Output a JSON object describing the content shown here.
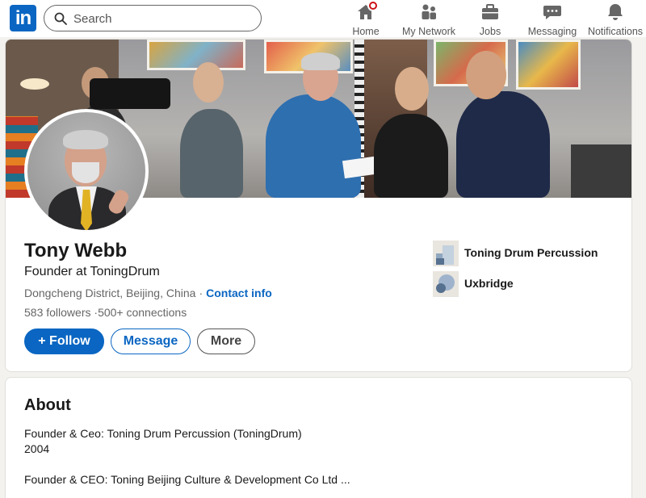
{
  "nav": {
    "logo": "in",
    "search_placeholder": "Search",
    "items": [
      {
        "label": "Home",
        "icon": "home-icon"
      },
      {
        "label": "My Network",
        "icon": "network-icon"
      },
      {
        "label": "Jobs",
        "icon": "briefcase-icon"
      },
      {
        "label": "Messaging",
        "icon": "messaging-icon"
      },
      {
        "label": "Notifications",
        "icon": "bell-icon"
      }
    ]
  },
  "profile": {
    "name": "Tony Webb",
    "headline": "Founder at ToningDrum",
    "location": "Dongcheng District, Beijing, China",
    "separator": "·",
    "contact_info": "Contact info",
    "followers": "583 followers",
    "connections": "500+ connections",
    "buttons": {
      "follow": "+ Follow",
      "message": "Message",
      "more": "More"
    },
    "orgs": [
      {
        "name": "Toning Drum Percussion",
        "icon": "company-logo-icon"
      },
      {
        "name": "Uxbridge",
        "icon": "school-logo-icon"
      }
    ]
  },
  "about": {
    "title": "About",
    "lines": [
      "Founder & Ceo: Toning Drum Percussion (ToningDrum)",
      "2004",
      "Founder & CEO: Toning Beijing Culture & Development Co Ltd ..."
    ]
  },
  "colors": {
    "brand": "#0a66c2",
    "page_bg": "#f3f2ef",
    "notification_badge": "#cc1016"
  }
}
